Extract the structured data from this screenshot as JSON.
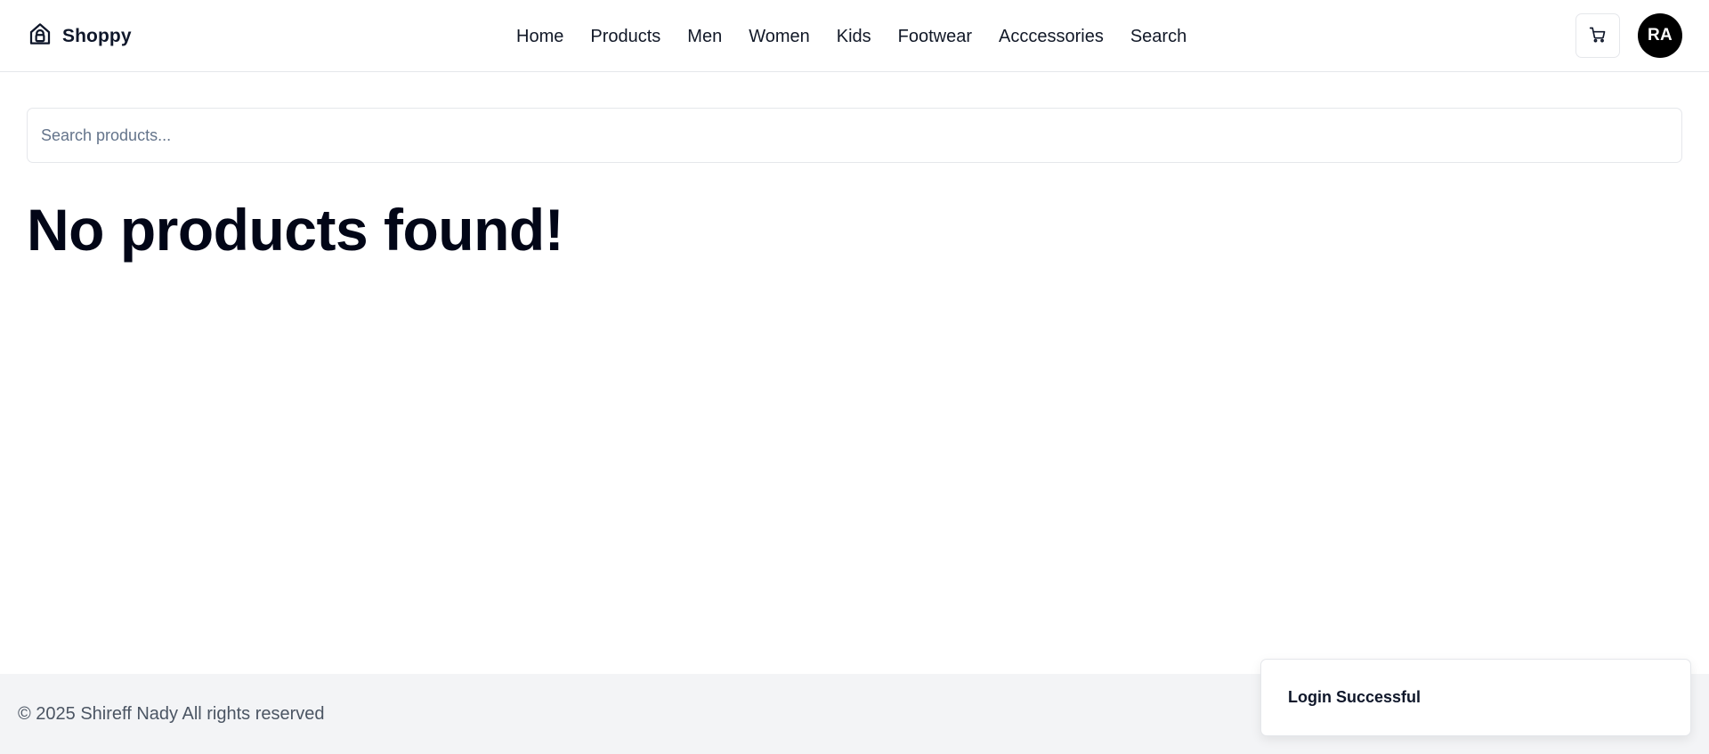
{
  "brand": {
    "name": "Shoppy",
    "icon": "shopping-bag-icon"
  },
  "nav": {
    "items": [
      {
        "label": "Home"
      },
      {
        "label": "Products"
      },
      {
        "label": "Men"
      },
      {
        "label": "Women"
      },
      {
        "label": "Kids"
      },
      {
        "label": "Footwear"
      },
      {
        "label": "Acccessories"
      },
      {
        "label": "Search"
      }
    ]
  },
  "header": {
    "cart_icon": "cart-icon",
    "avatar_initials": "RA"
  },
  "search": {
    "placeholder": "Search products...",
    "value": ""
  },
  "main": {
    "empty_message": "No products found!"
  },
  "footer": {
    "text": "© 2025 Shireff Nady All rights reserved"
  },
  "toast": {
    "message": "Login Successful"
  },
  "colors": {
    "text": "#0f172a",
    "border": "#e5e7eb",
    "footer_bg": "#f3f4f6",
    "avatar_bg": "#000000"
  }
}
